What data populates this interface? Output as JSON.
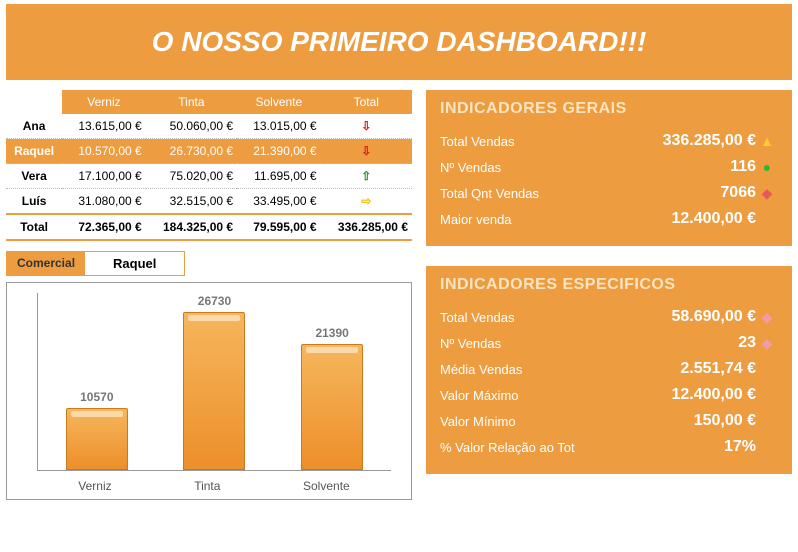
{
  "header": {
    "title": "O NOSSO PRIMEIRO DASHBOARD!!!"
  },
  "selector": {
    "label": "Comercial",
    "value": "Raquel"
  },
  "table": {
    "headers": [
      "",
      "Verniz",
      "Tinta",
      "Solvente",
      "Total"
    ],
    "rows": [
      {
        "name": "Ana",
        "verniz": "13.615,00 €",
        "tinta": "50.060,00 €",
        "solvente": "13.015,00 €",
        "total_icon": "down",
        "selected": false
      },
      {
        "name": "Raquel",
        "verniz": "10.570,00 €",
        "tinta": "26.730,00 €",
        "solvente": "21.390,00 €",
        "total_icon": "down",
        "selected": true
      },
      {
        "name": "Vera",
        "verniz": "17.100,00 €",
        "tinta": "75.020,00 €",
        "solvente": "11.695,00 €",
        "total_icon": "up",
        "selected": false
      },
      {
        "name": "Luís",
        "verniz": "31.080,00 €",
        "tinta": "32.515,00 €",
        "solvente": "33.495,00 €",
        "total_icon": "flat",
        "selected": false
      }
    ],
    "total": {
      "name": "Total",
      "verniz": "72.365,00 €",
      "tinta": "184.325,00 €",
      "solvente": "79.595,00 €",
      "grand": "336.285,00 €"
    }
  },
  "indicadores_gerais": {
    "title": "INDICADORES GERAIS",
    "items": [
      {
        "label": "Total Vendas",
        "value": "336.285,00 €",
        "shape": "tri"
      },
      {
        "label": "Nº Vendas",
        "value": "116",
        "shape": "cir"
      },
      {
        "label": "Total Qnt Vendas",
        "value": "7066",
        "shape": "dia"
      },
      {
        "label": "Maior venda",
        "value": "12.400,00 €",
        "shape": ""
      }
    ]
  },
  "indicadores_especificos": {
    "title": "INDICADORES ESPECIFICOS",
    "items": [
      {
        "label": "Total Vendas",
        "value": "58.690,00 €",
        "shape": "dia-pink"
      },
      {
        "label": "Nº Vendas",
        "value": "23",
        "shape": "dia-pink"
      },
      {
        "label": "Média Vendas",
        "value": "2.551,74 €",
        "shape": ""
      },
      {
        "label": "Valor Máximo",
        "value": "12.400,00 €",
        "shape": ""
      },
      {
        "label": "Valor Mínimo",
        "value": "150,00 €",
        "shape": ""
      },
      {
        "label": "% Valor Relação ao Tot",
        "value": "17%",
        "shape": ""
      }
    ]
  },
  "chart_data": {
    "type": "bar",
    "categories": [
      "Verniz",
      "Tinta",
      "Solvente"
    ],
    "values": [
      10570,
      26730,
      21390
    ],
    "title": "",
    "xlabel": "",
    "ylabel": "",
    "ylim": [
      0,
      30000
    ]
  }
}
